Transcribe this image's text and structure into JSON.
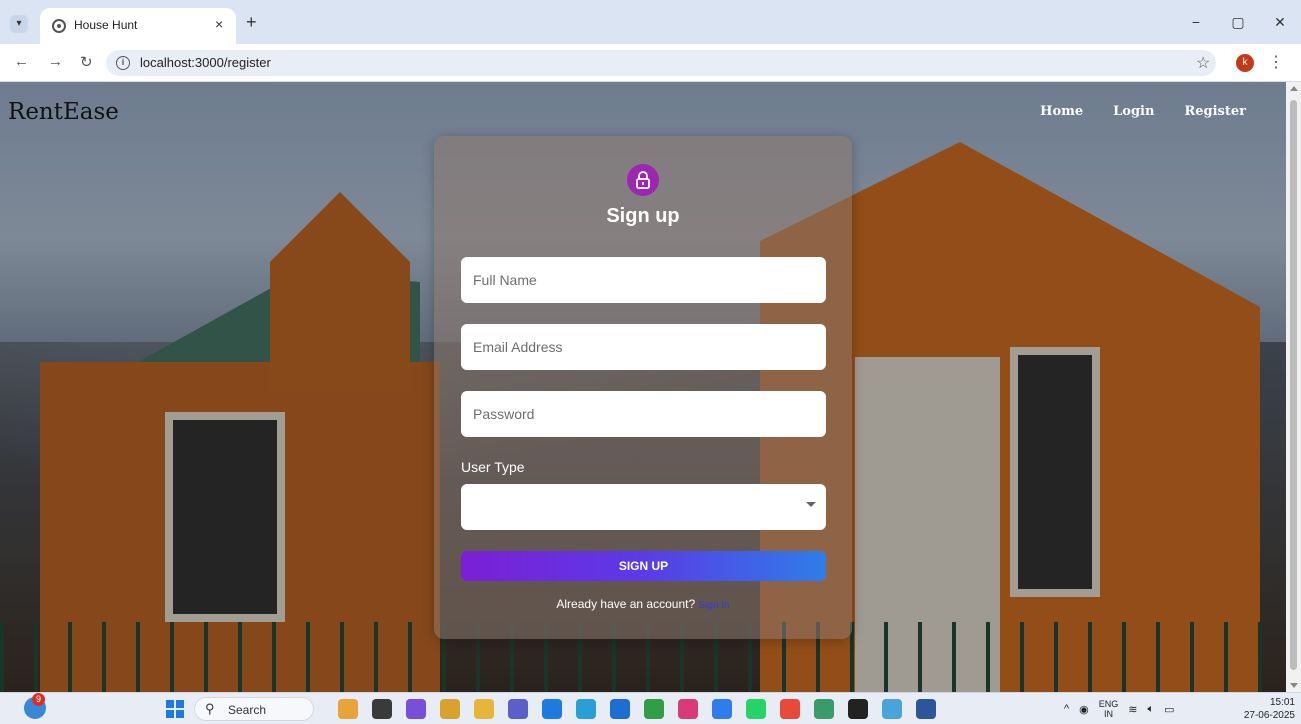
{
  "browser": {
    "tab_title": "House Hunt",
    "tab_close": "×",
    "new_tab": "+",
    "url": "localhost:3000/register",
    "profile_initial": "k",
    "window_controls": [
      "−",
      "▢",
      "✕"
    ]
  },
  "navbar": {
    "brand": "RentEase",
    "links": [
      "Home",
      "Login",
      "Register"
    ]
  },
  "form": {
    "title": "Sign up",
    "full_name_placeholder": "Full Name",
    "email_placeholder": "Email Address",
    "password_placeholder": "Password",
    "user_type_label": "User Type",
    "user_type_value": "",
    "submit_label": "SIGN UP",
    "signin_prompt": "Already have an account?",
    "signin_link": "Sign In"
  },
  "taskbar": {
    "weather_badge": "9",
    "search_label": "Search",
    "tray_lang_top": "ENG",
    "tray_lang_bottom": "IN",
    "time": "15:01",
    "date": "27-06-2025",
    "app_colors": [
      "#e8a33a",
      "#3a3a3a",
      "#7a4fd8",
      "#d9a22e",
      "#e6b53a",
      "#5b5fc7",
      "#1f7ae0",
      "#2a9fd6",
      "#1c6fd1",
      "#2f9e44",
      "#d93a7a",
      "#2f7de8",
      "#25d366",
      "#e84a3a",
      "#3a9a6a",
      "#222222",
      "#4aa3d9",
      "#2b579a"
    ]
  },
  "colors": {
    "lock_avatar": "#9c27b0",
    "button_start": "#7b1fd6",
    "button_end": "#2f7de8",
    "signin_link": "#3a37e6"
  }
}
